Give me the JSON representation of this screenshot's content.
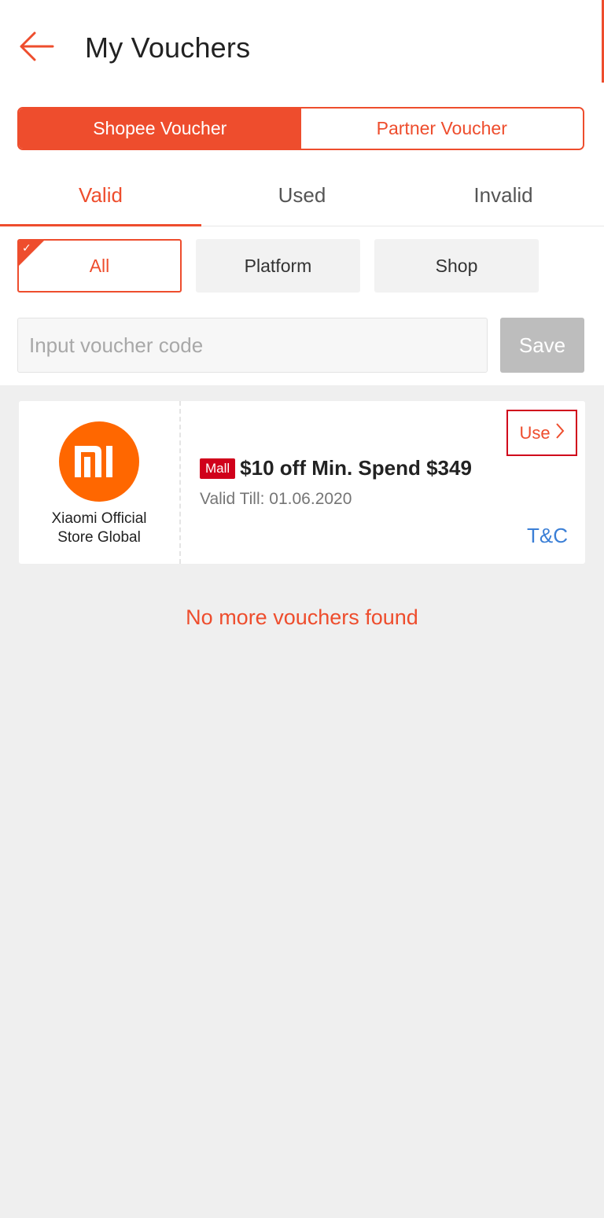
{
  "header": {
    "title": "My Vouchers",
    "back_icon": "arrow-left-icon"
  },
  "voucher_type": {
    "items": [
      {
        "label": "Shopee Voucher",
        "selected": true
      },
      {
        "label": "Partner Voucher",
        "selected": false
      }
    ]
  },
  "status_tabs": {
    "items": [
      {
        "label": "Valid",
        "selected": true
      },
      {
        "label": "Used",
        "selected": false
      },
      {
        "label": "Invalid",
        "selected": false
      }
    ]
  },
  "filters": {
    "items": [
      {
        "label": "All",
        "selected": true
      },
      {
        "label": "Platform",
        "selected": false
      },
      {
        "label": "Shop",
        "selected": false
      }
    ]
  },
  "code_entry": {
    "placeholder": "Input voucher code",
    "value": "",
    "save_label": "Save"
  },
  "vouchers": [
    {
      "logo_icon": "xiaomi-mi-logo",
      "shop_name_line1": "Xiaomi Official",
      "shop_name_line2": "Store Global",
      "badge": "Mall",
      "title": "$10 off Min. Spend $349",
      "valid_till": "Valid Till: 01.06.2020",
      "use_label": "Use",
      "tnc_label": "T&C"
    }
  ],
  "footer_message": "No more vouchers found",
  "colors": {
    "accent": "#ee4d2d",
    "mall_badge": "#d0011b",
    "link_blue": "#3b7fd6",
    "xiaomi_orange": "#ff6700",
    "save_disabled": "#bdbdbd",
    "page_background": "#efefef"
  }
}
